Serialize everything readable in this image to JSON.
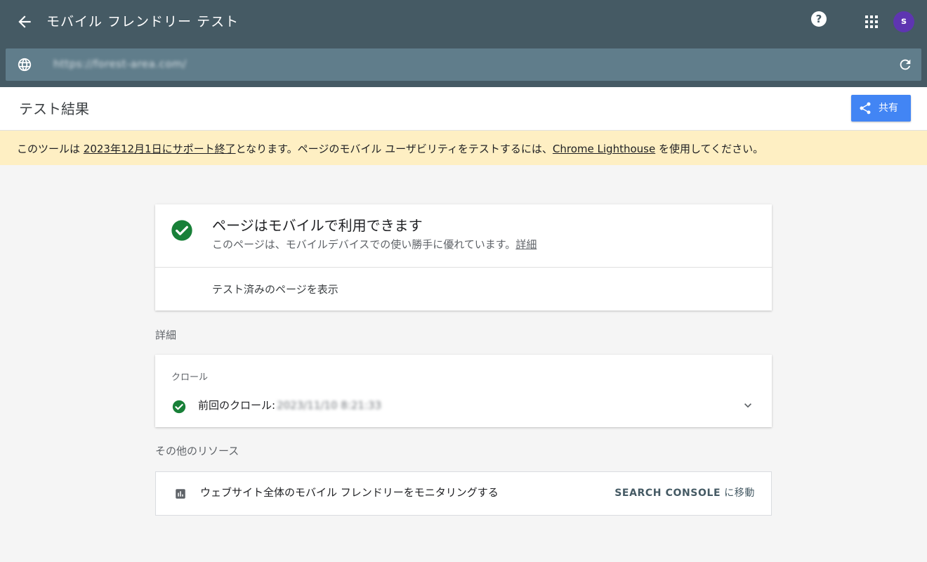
{
  "header": {
    "title": "モバイル フレンドリー テスト",
    "help_label": "?",
    "avatar_initial": "s"
  },
  "urlbar": {
    "url": "https://forest-area.com/"
  },
  "result_bar": {
    "title": "テスト結果",
    "share_label": "共有"
  },
  "notice": {
    "prefix": "このツールは ",
    "link1": "2023年12月1日にサポート終了",
    "middle": "となります。ページのモバイル ユーザビリティをテストするには、",
    "link2": "Chrome Lighthouse",
    "suffix": " を使用してください。",
    "bg_color": "#feefc3"
  },
  "result": {
    "heading": "ページはモバイルで利用できます",
    "description": "このページは、モバイルデバイスでの使い勝手に優れています。",
    "details_link": "詳細",
    "view_tested_page": "テスト済みのページを表示",
    "status_color": "#188038"
  },
  "details": {
    "section_label": "詳細",
    "crawl_label": "クロール",
    "last_crawl_label": "前回のクロール:",
    "last_crawl_value": "2023/11/10 8:21:33"
  },
  "resources": {
    "section_label": "その他のリソース",
    "item_text": "ウェブサイト全体のモバイル フレンドリーをモニタリングする",
    "link_bold": "SEARCH CONSOLE",
    "link_suffix": " に移動"
  },
  "colors": {
    "topbar": "#455a64",
    "urlbar": "#607d8b",
    "accent": "#4285f4",
    "avatar": "#5e35b1"
  }
}
